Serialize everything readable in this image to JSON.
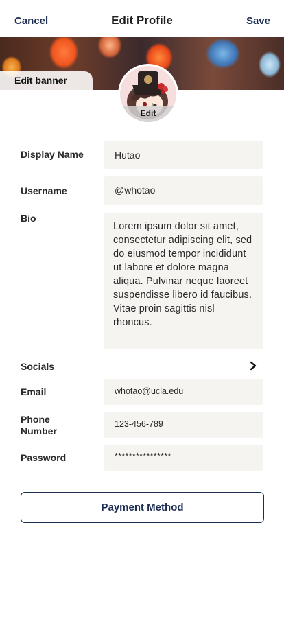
{
  "header": {
    "cancel_label": "Cancel",
    "title": "Edit Profile",
    "save_label": "Save"
  },
  "banner": {
    "edit_label": "Edit banner"
  },
  "avatar": {
    "edit_label": "Edit"
  },
  "form": {
    "display_name": {
      "label": "Display Name",
      "value": "Hutao"
    },
    "username": {
      "label": "Username",
      "value": "@whotao"
    },
    "bio": {
      "label": "Bio",
      "value": "Lorem ipsum dolor sit amet, consectetur adipiscing elit, sed do eiusmod tempor incididunt ut labore et dolore magna aliqua. Pulvinar neque laoreet suspendisse libero id faucibus. Vitae proin sagittis nisl rhoncus."
    },
    "socials": {
      "label": "Socials"
    },
    "email": {
      "label": "Email",
      "value": "whotao@ucla.edu"
    },
    "phone": {
      "label_line1": "Phone",
      "label_line2": "Number",
      "value": "123-456-789"
    },
    "password": {
      "label": "Password",
      "value": "****************"
    }
  },
  "payment_button_label": "Payment Method",
  "colors": {
    "accent": "#1c2d52",
    "field_bg": "#f5f4f0"
  },
  "icons": {
    "socials_chevron": "chevron-right-icon"
  }
}
